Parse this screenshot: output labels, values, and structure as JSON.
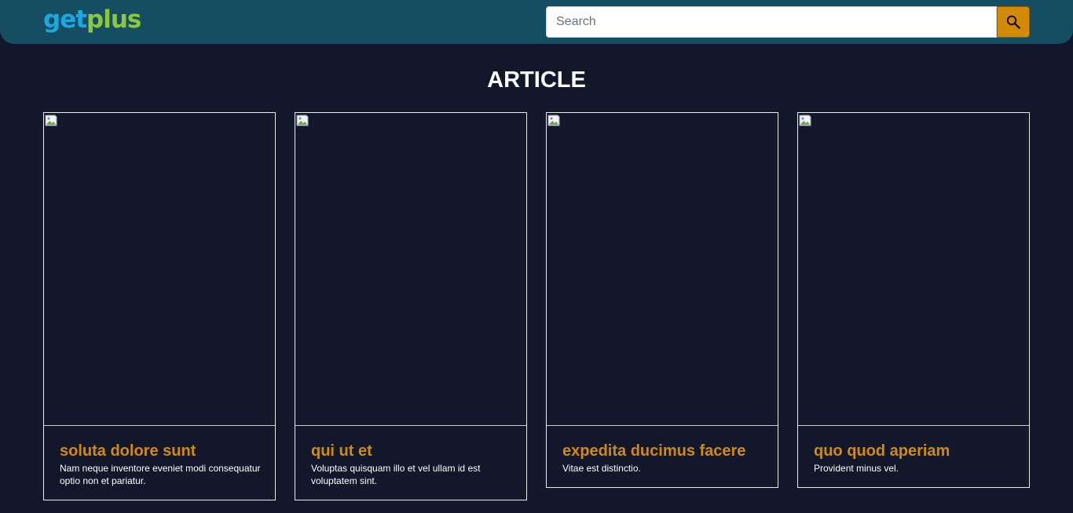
{
  "header": {
    "logo_get": "get",
    "logo_plus": "plus",
    "search_placeholder": "Search",
    "search_icon": "magnifier-icon"
  },
  "main": {
    "title": "ARTICLE",
    "cards": [
      {
        "title": "soluta dolore sunt",
        "text": "Nam neque inventore eveniet modi consequatur optio non et pariatur."
      },
      {
        "title": "qui ut et",
        "text": "Voluptas quisquam illo et vel ullam id est voluptatem sint."
      },
      {
        "title": "expedita ducimus facere",
        "text": "Vitae est distinctio."
      },
      {
        "title": "quo quod aperiam",
        "text": "Provident minus vel."
      }
    ]
  },
  "colors": {
    "background": "#12182a",
    "header": "#154e63",
    "accent": "#d38a07",
    "logo_blue": "#1ba7e0",
    "logo_green": "#8cc63f"
  }
}
